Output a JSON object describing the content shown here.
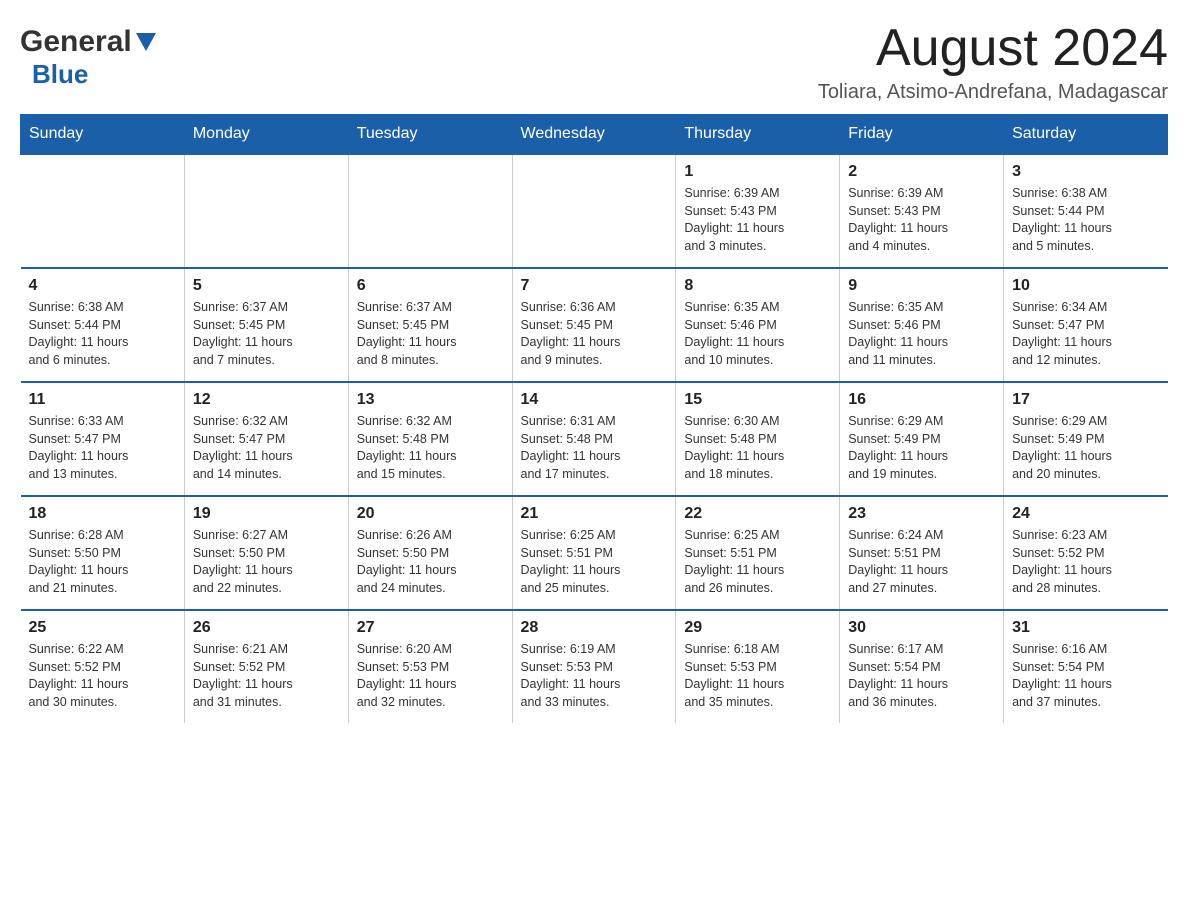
{
  "header": {
    "logo_general": "General",
    "logo_blue": "Blue",
    "month_title": "August 2024",
    "location": "Toliara, Atsimo-Andrefana, Madagascar"
  },
  "days_of_week": [
    "Sunday",
    "Monday",
    "Tuesday",
    "Wednesday",
    "Thursday",
    "Friday",
    "Saturday"
  ],
  "weeks": [
    {
      "cells": [
        {
          "day": "",
          "info": ""
        },
        {
          "day": "",
          "info": ""
        },
        {
          "day": "",
          "info": ""
        },
        {
          "day": "",
          "info": ""
        },
        {
          "day": "1",
          "info": "Sunrise: 6:39 AM\nSunset: 5:43 PM\nDaylight: 11 hours\nand 3 minutes."
        },
        {
          "day": "2",
          "info": "Sunrise: 6:39 AM\nSunset: 5:43 PM\nDaylight: 11 hours\nand 4 minutes."
        },
        {
          "day": "3",
          "info": "Sunrise: 6:38 AM\nSunset: 5:44 PM\nDaylight: 11 hours\nand 5 minutes."
        }
      ]
    },
    {
      "cells": [
        {
          "day": "4",
          "info": "Sunrise: 6:38 AM\nSunset: 5:44 PM\nDaylight: 11 hours\nand 6 minutes."
        },
        {
          "day": "5",
          "info": "Sunrise: 6:37 AM\nSunset: 5:45 PM\nDaylight: 11 hours\nand 7 minutes."
        },
        {
          "day": "6",
          "info": "Sunrise: 6:37 AM\nSunset: 5:45 PM\nDaylight: 11 hours\nand 8 minutes."
        },
        {
          "day": "7",
          "info": "Sunrise: 6:36 AM\nSunset: 5:45 PM\nDaylight: 11 hours\nand 9 minutes."
        },
        {
          "day": "8",
          "info": "Sunrise: 6:35 AM\nSunset: 5:46 PM\nDaylight: 11 hours\nand 10 minutes."
        },
        {
          "day": "9",
          "info": "Sunrise: 6:35 AM\nSunset: 5:46 PM\nDaylight: 11 hours\nand 11 minutes."
        },
        {
          "day": "10",
          "info": "Sunrise: 6:34 AM\nSunset: 5:47 PM\nDaylight: 11 hours\nand 12 minutes."
        }
      ]
    },
    {
      "cells": [
        {
          "day": "11",
          "info": "Sunrise: 6:33 AM\nSunset: 5:47 PM\nDaylight: 11 hours\nand 13 minutes."
        },
        {
          "day": "12",
          "info": "Sunrise: 6:32 AM\nSunset: 5:47 PM\nDaylight: 11 hours\nand 14 minutes."
        },
        {
          "day": "13",
          "info": "Sunrise: 6:32 AM\nSunset: 5:48 PM\nDaylight: 11 hours\nand 15 minutes."
        },
        {
          "day": "14",
          "info": "Sunrise: 6:31 AM\nSunset: 5:48 PM\nDaylight: 11 hours\nand 17 minutes."
        },
        {
          "day": "15",
          "info": "Sunrise: 6:30 AM\nSunset: 5:48 PM\nDaylight: 11 hours\nand 18 minutes."
        },
        {
          "day": "16",
          "info": "Sunrise: 6:29 AM\nSunset: 5:49 PM\nDaylight: 11 hours\nand 19 minutes."
        },
        {
          "day": "17",
          "info": "Sunrise: 6:29 AM\nSunset: 5:49 PM\nDaylight: 11 hours\nand 20 minutes."
        }
      ]
    },
    {
      "cells": [
        {
          "day": "18",
          "info": "Sunrise: 6:28 AM\nSunset: 5:50 PM\nDaylight: 11 hours\nand 21 minutes."
        },
        {
          "day": "19",
          "info": "Sunrise: 6:27 AM\nSunset: 5:50 PM\nDaylight: 11 hours\nand 22 minutes."
        },
        {
          "day": "20",
          "info": "Sunrise: 6:26 AM\nSunset: 5:50 PM\nDaylight: 11 hours\nand 24 minutes."
        },
        {
          "day": "21",
          "info": "Sunrise: 6:25 AM\nSunset: 5:51 PM\nDaylight: 11 hours\nand 25 minutes."
        },
        {
          "day": "22",
          "info": "Sunrise: 6:25 AM\nSunset: 5:51 PM\nDaylight: 11 hours\nand 26 minutes."
        },
        {
          "day": "23",
          "info": "Sunrise: 6:24 AM\nSunset: 5:51 PM\nDaylight: 11 hours\nand 27 minutes."
        },
        {
          "day": "24",
          "info": "Sunrise: 6:23 AM\nSunset: 5:52 PM\nDaylight: 11 hours\nand 28 minutes."
        }
      ]
    },
    {
      "cells": [
        {
          "day": "25",
          "info": "Sunrise: 6:22 AM\nSunset: 5:52 PM\nDaylight: 11 hours\nand 30 minutes."
        },
        {
          "day": "26",
          "info": "Sunrise: 6:21 AM\nSunset: 5:52 PM\nDaylight: 11 hours\nand 31 minutes."
        },
        {
          "day": "27",
          "info": "Sunrise: 6:20 AM\nSunset: 5:53 PM\nDaylight: 11 hours\nand 32 minutes."
        },
        {
          "day": "28",
          "info": "Sunrise: 6:19 AM\nSunset: 5:53 PM\nDaylight: 11 hours\nand 33 minutes."
        },
        {
          "day": "29",
          "info": "Sunrise: 6:18 AM\nSunset: 5:53 PM\nDaylight: 11 hours\nand 35 minutes."
        },
        {
          "day": "30",
          "info": "Sunrise: 6:17 AM\nSunset: 5:54 PM\nDaylight: 11 hours\nand 36 minutes."
        },
        {
          "day": "31",
          "info": "Sunrise: 6:16 AM\nSunset: 5:54 PM\nDaylight: 11 hours\nand 37 minutes."
        }
      ]
    }
  ]
}
